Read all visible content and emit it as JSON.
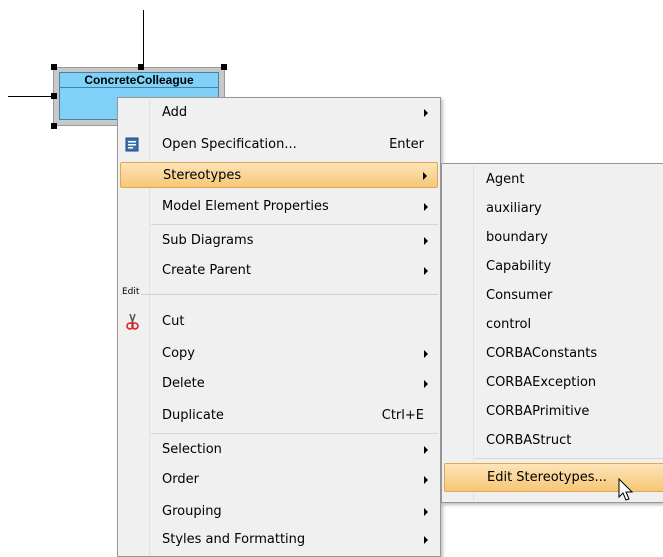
{
  "diagram": {
    "class_name": "ConcreteColleague"
  },
  "context_menu": {
    "items": [
      {
        "label": "Add",
        "shortcut": "",
        "submenu": true
      },
      {
        "label": "Open Specification...",
        "shortcut": "Enter",
        "submenu": false,
        "icon": "specification-icon"
      },
      {
        "label": "Stereotypes",
        "shortcut": "",
        "submenu": true,
        "highlighted": true
      },
      {
        "label": "Model Element Properties",
        "shortcut": "",
        "submenu": true
      },
      {
        "label": "Sub Diagrams",
        "shortcut": "",
        "submenu": true
      },
      {
        "label": "Create Parent",
        "shortcut": "",
        "submenu": true
      },
      {
        "label": "Cut",
        "shortcut": "",
        "submenu": false,
        "icon": "scissors-icon"
      },
      {
        "label": "Copy",
        "shortcut": "",
        "submenu": true
      },
      {
        "label": "Delete",
        "shortcut": "",
        "submenu": true
      },
      {
        "label": "Duplicate",
        "shortcut": "Ctrl+E",
        "submenu": false
      },
      {
        "label": "Selection",
        "shortcut": "",
        "submenu": true
      },
      {
        "label": "Order",
        "shortcut": "",
        "submenu": true
      },
      {
        "label": "Grouping",
        "shortcut": "",
        "submenu": true
      },
      {
        "label": "Styles and Formatting",
        "shortcut": "",
        "submenu": true
      }
    ],
    "group_label_edit": "Edit"
  },
  "stereotypes_submenu": {
    "items": [
      {
        "label": "Agent"
      },
      {
        "label": "auxiliary"
      },
      {
        "label": "boundary"
      },
      {
        "label": "Capability"
      },
      {
        "label": "Consumer"
      },
      {
        "label": "control"
      },
      {
        "label": "CORBAConstants"
      },
      {
        "label": "CORBAException"
      },
      {
        "label": "CORBAPrimitive"
      },
      {
        "label": "CORBAStruct"
      },
      {
        "label": "Edit Stereotypes...",
        "highlighted": true
      }
    ]
  },
  "colors": {
    "class_fill": "#7fd1f7",
    "highlight": "#f6c777",
    "menu_bg": "#f0f0f0"
  }
}
